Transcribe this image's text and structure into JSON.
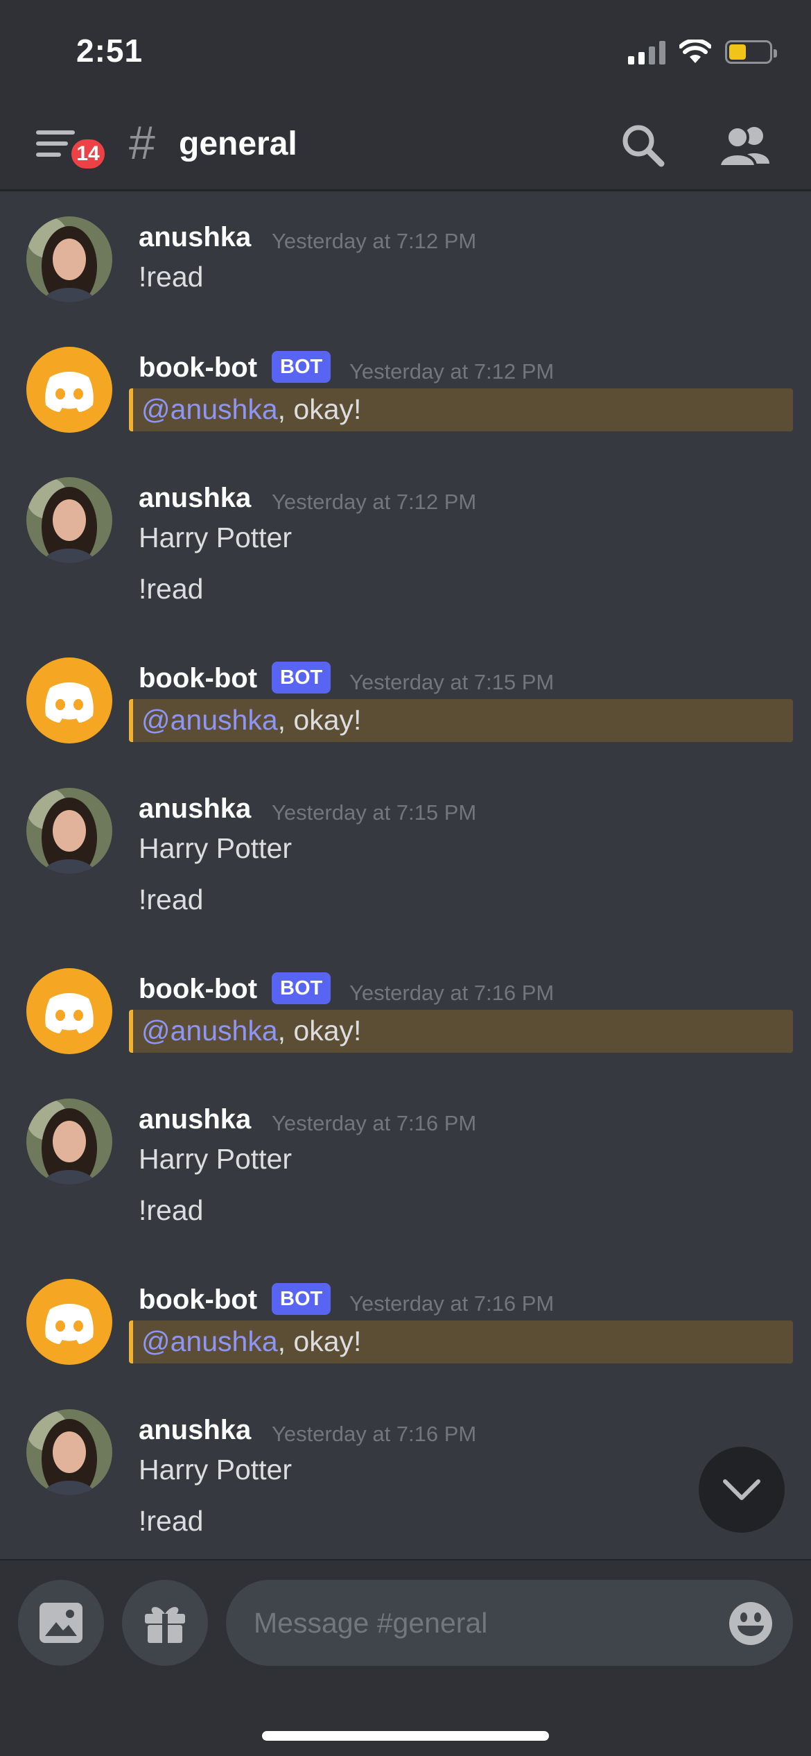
{
  "status_bar": {
    "time": "2:51"
  },
  "header": {
    "menu_badge": "14",
    "channel_hash": "#",
    "channel_name": "general"
  },
  "messages": [
    {
      "author": "anushka",
      "is_bot": false,
      "timestamp": "Yesterday at 7:12 PM",
      "lines": [
        "!read"
      ]
    },
    {
      "author": "book-bot",
      "is_bot": true,
      "bot_tag": "BOT",
      "timestamp": "Yesterday at 7:12 PM",
      "mention": "@anushka",
      "text": ", okay!"
    },
    {
      "author": "anushka",
      "is_bot": false,
      "timestamp": "Yesterday at 7:12 PM",
      "lines": [
        "Harry Potter",
        "!read"
      ]
    },
    {
      "author": "book-bot",
      "is_bot": true,
      "bot_tag": "BOT",
      "timestamp": "Yesterday at 7:15 PM",
      "mention": "@anushka",
      "text": ", okay!"
    },
    {
      "author": "anushka",
      "is_bot": false,
      "timestamp": "Yesterday at 7:15 PM",
      "lines": [
        "Harry Potter",
        "!read"
      ]
    },
    {
      "author": "book-bot",
      "is_bot": true,
      "bot_tag": "BOT",
      "timestamp": "Yesterday at 7:16 PM",
      "mention": "@anushka",
      "text": ", okay!"
    },
    {
      "author": "anushka",
      "is_bot": false,
      "timestamp": "Yesterday at 7:16 PM",
      "lines": [
        "Harry Potter",
        "!read"
      ]
    },
    {
      "author": "book-bot",
      "is_bot": true,
      "bot_tag": "BOT",
      "timestamp": "Yesterday at 7:16 PM",
      "mention": "@anushka",
      "text": ", okay!"
    },
    {
      "author": "anushka",
      "is_bot": false,
      "timestamp": "Yesterday at 7:16 PM",
      "lines": [
        "Harry Potter",
        "!read"
      ]
    }
  ],
  "composer": {
    "placeholder": "Message #general"
  },
  "colors": {
    "background": "#36393f",
    "header": "#2f3136",
    "bot_tag": "#5865f2",
    "mention_highlight": "#5b4e35",
    "mention_border": "#f0b232",
    "mention_text": "#8d96f5",
    "badge": "#ed4245",
    "bot_avatar": "#f5a623"
  },
  "icons": [
    "menu-icon",
    "search-icon",
    "members-icon",
    "discord-logo-icon",
    "chevron-down-icon",
    "image-icon",
    "gift-icon",
    "emoji-icon",
    "signal-icon",
    "wifi-icon",
    "battery-icon"
  ]
}
